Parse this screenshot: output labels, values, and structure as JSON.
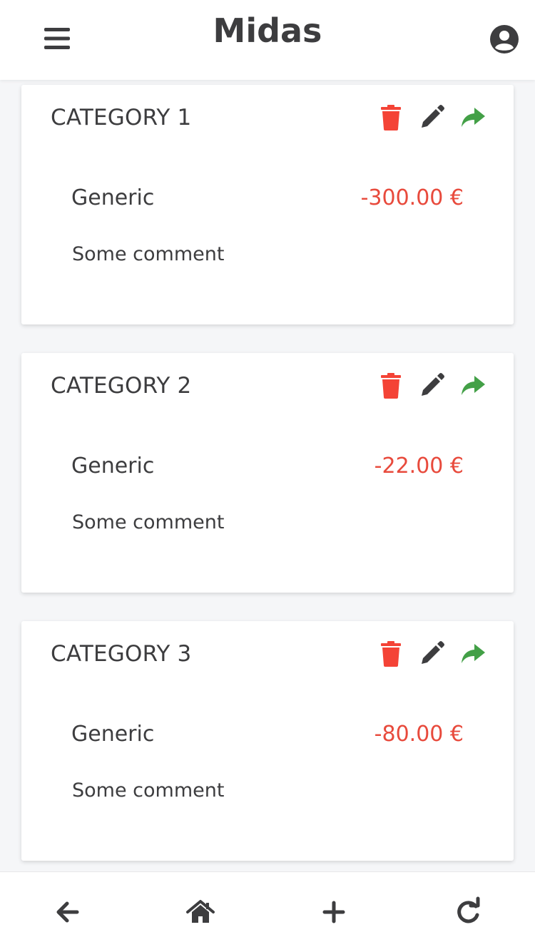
{
  "app": {
    "title": "Midas"
  },
  "header": {
    "menu_icon": "hamburger-menu-icon",
    "account_icon": "user-circle-icon"
  },
  "colors": {
    "danger": "#f44336",
    "amount_negative": "#e84a3c",
    "success": "#43a047",
    "text": "#3d3d3f"
  },
  "cards": [
    {
      "category": "CATEGORY 1",
      "name": "Generic",
      "amount": "-300.00 €",
      "comment": "Some comment"
    },
    {
      "category": "CATEGORY 2",
      "name": "Generic",
      "amount": "-22.00 €",
      "comment": "Some comment"
    },
    {
      "category": "CATEGORY 3",
      "name": "Generic",
      "amount": "-80.00 €",
      "comment": "Some comment"
    }
  ],
  "card_actions": {
    "delete_icon": "trash-icon",
    "edit_icon": "pencil-icon",
    "share_icon": "share-arrow-icon"
  },
  "bottom_nav": {
    "items": [
      "arrow-left-icon",
      "home-icon",
      "plus-icon",
      "refresh-icon"
    ]
  }
}
